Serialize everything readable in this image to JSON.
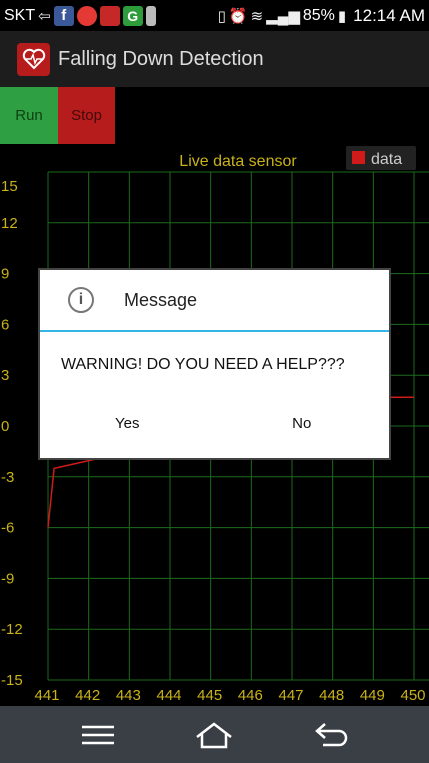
{
  "status_bar": {
    "carrier": "SKT",
    "battery": "85%",
    "time": "12:14 AM",
    "icons": [
      "back-arrow-icon",
      "facebook-icon",
      "opera-icon",
      "app-icon",
      "green-g-icon",
      "sim-icon",
      "vibrate-icon",
      "alarm-icon",
      "wifi-icon",
      "signal-icon",
      "battery-icon"
    ]
  },
  "app": {
    "title": "Falling Down Detection",
    "icon": "heart-monitor-icon"
  },
  "controls": {
    "run_label": "Run",
    "stop_label": "Stop"
  },
  "colors": {
    "run": "#2ea043",
    "stop": "#b71c1c",
    "axis_text": "#c9b21a",
    "grid": "#1d6b1d",
    "series": "#d11a1a",
    "dialog_divider": "#33b5e5"
  },
  "chart_data": {
    "type": "line",
    "title": "Live data sensor",
    "legend": [
      "data"
    ],
    "legend_position": "top-right",
    "grid": true,
    "ylim": [
      -15,
      15
    ],
    "yticks": [
      "15",
      "12",
      "9",
      "6",
      "3",
      "0",
      "-3",
      "-6",
      "-9",
      "-12",
      "-15"
    ],
    "xlim": [
      441,
      450
    ],
    "xticks": [
      "441",
      "442",
      "443",
      "444",
      "445",
      "446",
      "447",
      "448",
      "449",
      "450"
    ],
    "series": [
      {
        "name": "data",
        "x": [
          441,
          441.15,
          449,
          450
        ],
        "y": [
          -6,
          -2.5,
          1.7,
          1.7
        ]
      }
    ]
  },
  "dialog": {
    "title": "Message",
    "message": "WARNING! DO YOU NEED A HELP???",
    "yes_label": "Yes",
    "no_label": "No",
    "icon": "info-icon"
  },
  "nav_bar": {
    "items": [
      "menu-icon",
      "home-icon",
      "back-icon"
    ]
  }
}
